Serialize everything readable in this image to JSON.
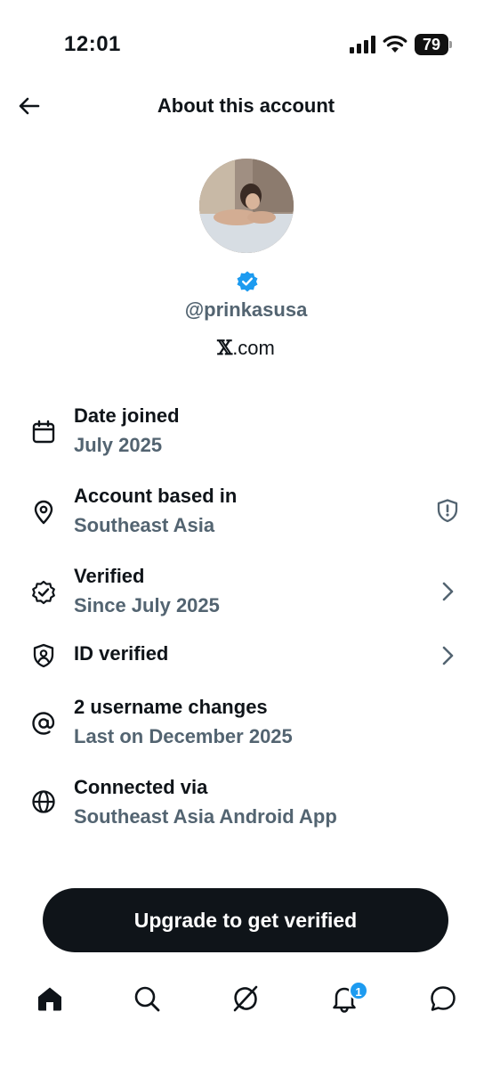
{
  "status_bar": {
    "time": "12:01",
    "battery_level": "79",
    "icons": [
      "signal-icon",
      "wifi-icon",
      "battery-icon"
    ]
  },
  "header": {
    "title": "About this account",
    "back_icon": "arrow-left-icon"
  },
  "profile": {
    "username": "@prinkasusa",
    "platform_mark": "𝕏",
    "platform_suffix": ".com",
    "verified_color": "#1d9bf0"
  },
  "details": [
    {
      "icon": "calendar-icon",
      "title": "Date joined",
      "value": "July 2025"
    },
    {
      "icon": "location-pin-icon",
      "title": "Account based in",
      "value": "Southeast Asia",
      "trailing_icon": "shield-alert-icon"
    },
    {
      "icon": "verified-badge-outline-icon",
      "title": "Verified",
      "value": "Since July 2025",
      "trailing_icon": "chevron-right-icon"
    },
    {
      "icon": "id-shield-icon",
      "title": "ID verified",
      "trailing_icon": "chevron-right-icon"
    },
    {
      "icon": "at-sign-icon",
      "title": "2 username changes",
      "value": "Last on December 2025"
    },
    {
      "icon": "globe-icon",
      "title": "Connected via",
      "value": "Southeast Asia Android App"
    }
  ],
  "cta": {
    "label": "Upgrade to get verified"
  },
  "tabbar": {
    "items": [
      "home-icon",
      "search-icon",
      "grok-icon",
      "bell-icon",
      "messages-icon"
    ],
    "notification_count": "1",
    "accent_color": "#1d9bf0"
  }
}
